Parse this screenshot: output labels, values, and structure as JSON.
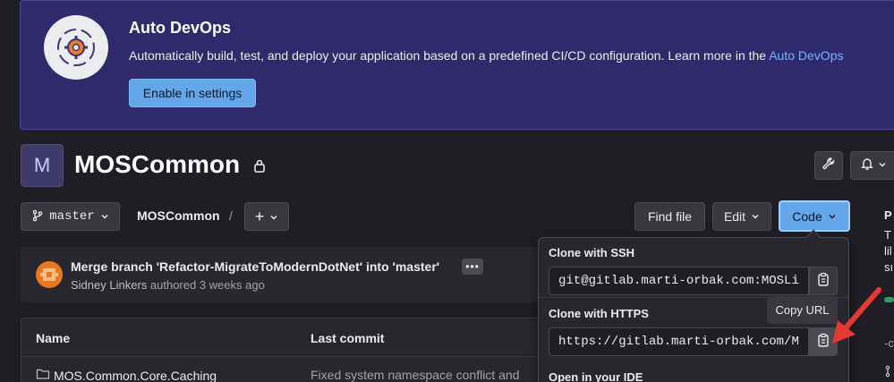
{
  "banner": {
    "title": "Auto DevOps",
    "description": "Automatically build, test, and deploy your application based on a predefined CI/CD configuration. Learn more in the ",
    "link_text": "Auto DevOps",
    "button_label": "Enable in settings"
  },
  "project": {
    "avatar_letter": "M",
    "title": "MOSCommon"
  },
  "toolbar": {
    "branch": "master",
    "breadcrumb": "MOSCommon",
    "breadcrumb_sep": "/",
    "add_label": "+",
    "find_file": "Find file",
    "edit": "Edit",
    "code": "Code"
  },
  "commit": {
    "title": "Merge branch 'Refactor-MigrateToModernDotNet' into 'master'",
    "author": "Sidney Linkers",
    "authored": " authored 3 weeks ago",
    "more": "•••"
  },
  "table": {
    "headers": [
      "Name",
      "Last commit"
    ],
    "rows": [
      {
        "name": "MOS.Common.Core.Caching",
        "last_commit": "Fixed system namespace conflict and"
      }
    ]
  },
  "clone": {
    "ssh_label": "Clone with SSH",
    "ssh_url": "git@gitlab.marti-orbak.com:MOSLi",
    "https_label": "Clone with HTTPS",
    "https_url": "https://gitlab.marti-orbak.com/M",
    "ide_label": "Open in your IDE",
    "tooltip": "Copy URL"
  },
  "sidebar": {
    "frag1": "P",
    "frag2": "T",
    "frag3": "lil",
    "frag4": "sı",
    "frag5": "-c"
  },
  "colors": {
    "banner_bg": "#2f2a6b",
    "confirm_button": "#63a6e9",
    "page_bg": "#1f1e24",
    "annotation_arrow": "#e53935"
  }
}
